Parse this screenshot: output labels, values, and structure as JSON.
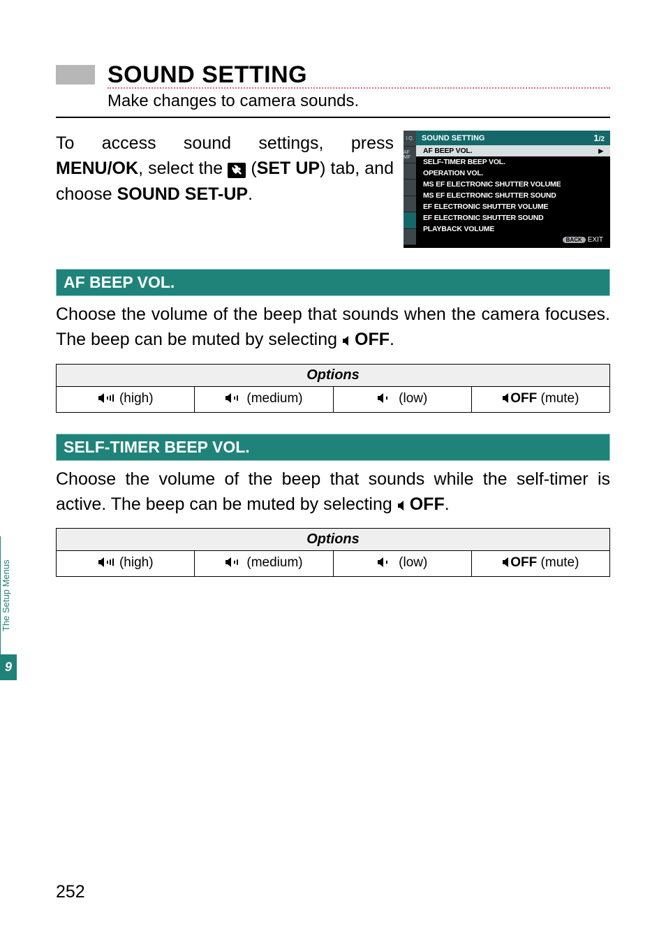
{
  "heading": "SOUND SETTING",
  "subheading": "Make changes to camera sounds.",
  "intro": {
    "part1": "To access sound settings, press ",
    "menuok": "MENU/OK",
    "part2": ", select the ",
    "setup": "SET UP",
    "part3": ") tab, and choose ",
    "soundsetup": "SOUND SET-UP",
    "part4": "."
  },
  "camscreen": {
    "title": "SOUND SETTING",
    "page_cur": "1",
    "page_sep": "/2",
    "tabs": [
      "I.Q.",
      "AF\nMF",
      "",
      "",
      "",
      "",
      ""
    ],
    "rows": [
      "AF BEEP VOL.",
      "SELF-TIMER BEEP VOL.",
      "OPERATION VOL.",
      "MS EF ELECTRONIC SHUTTER VOLUME",
      "MS EF ELECTRONIC SHUTTER SOUND",
      "EF ELECTRONIC SHUTTER VOLUME",
      "EF ELECTRONIC SHUTTER SOUND",
      "PLAYBACK VOLUME"
    ],
    "back": "BACK",
    "exit": "EXIT"
  },
  "sections": [
    {
      "title": "AF BEEP VOL.",
      "desc_a": "Choose the volume of the beep that sounds when the camera focuses. The beep can be muted by selecting ",
      "desc_off": "OFF",
      "desc_b": "."
    },
    {
      "title": "SELF-TIMER BEEP VOL.",
      "desc_a": "Choose the volume of the beep that sounds while the self-timer is active. The beep can be muted by selecting ",
      "desc_off": "OFF",
      "desc_b": "."
    }
  ],
  "options_header": "Options",
  "options": [
    {
      "label": " (high)",
      "bars": 3
    },
    {
      "label": " (medium)",
      "bars": 2
    },
    {
      "label": " (low)",
      "bars": 1
    },
    {
      "label": " (mute)",
      "bars": 0,
      "off": "OFF"
    }
  ],
  "sidetab": {
    "label": "The Setup Menus",
    "num": "9"
  },
  "pagenum": "252"
}
